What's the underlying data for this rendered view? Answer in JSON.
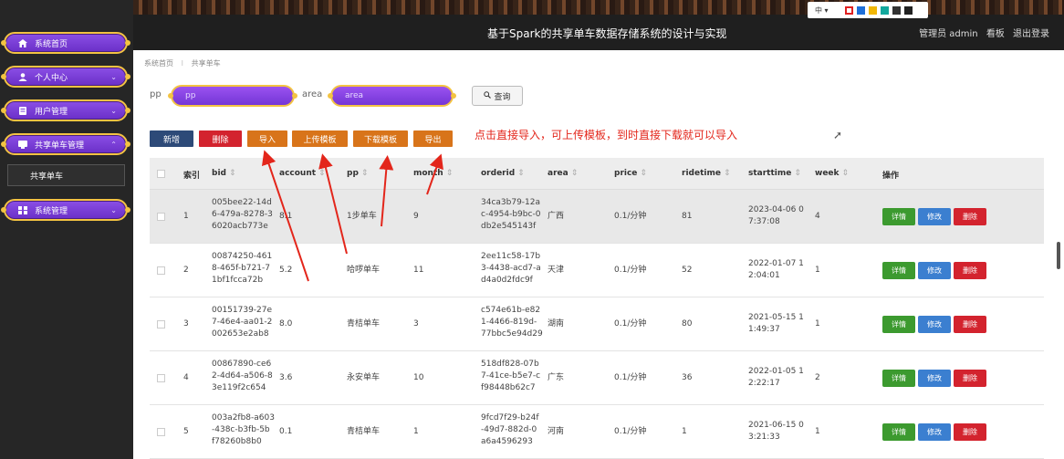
{
  "sidebar": {
    "items": [
      {
        "label": "系统首页",
        "icon": "home-icon",
        "chevron": ""
      },
      {
        "label": "个人中心",
        "icon": "user-icon",
        "chevron": "⌄"
      },
      {
        "label": "用户管理",
        "icon": "user-manage-icon",
        "chevron": "⌄"
      },
      {
        "label": "共享单车管理",
        "icon": "bike-manage-icon",
        "chevron": "⌃"
      },
      {
        "label": "系统管理",
        "icon": "grid-icon",
        "chevron": "⌄"
      }
    ],
    "submenu_item": "共享单车"
  },
  "header": {
    "title": "基于Spark的共享单车数据存储系统的设计与实现",
    "role": "管理员 admin",
    "board": "看板",
    "logout": "退出登录",
    "lang": "中 ▾",
    "theme_colors": [
      "#e02020",
      "#1e6fd9",
      "#f2b705",
      "#13a89e",
      "#333333",
      "#222222"
    ]
  },
  "breadcrumb": {
    "home": "系统首页",
    "sep": "⁝",
    "current": "共享单车"
  },
  "search": {
    "pp_label": "pp",
    "pp_placeholder": "pp",
    "area_label": "area",
    "area_placeholder": "area",
    "query_label": "查询"
  },
  "actions": {
    "add": "新增",
    "delete": "删除",
    "import": "导入",
    "upload_template": "上传模板",
    "download_template": "下载模板",
    "export": "导出"
  },
  "annotation": "点击直接导入，可上传模板，到时直接下载就可以导入",
  "table": {
    "columns": [
      "索引",
      "bid",
      "account",
      "pp",
      "month",
      "orderid",
      "area",
      "price",
      "ridetime",
      "starttime",
      "week",
      "操作"
    ],
    "row_actions": {
      "detail": "详情",
      "edit": "修改",
      "delete": "删除"
    },
    "rows": [
      {
        "index": "1",
        "bid": [
          "005bee22-14d",
          "6-479a-8278-3",
          "6020acb773e"
        ],
        "account": "8.1",
        "pp": "1步单车",
        "month": "9",
        "orderid": [
          "34ca3b79-12a",
          "c-4954-b9bc-0",
          "db2e545143f"
        ],
        "area": "广西",
        "price": "0.1/分钟",
        "ridetime": "81",
        "starttime": [
          "2023-04-06 0",
          "7:37:08"
        ],
        "week": "4"
      },
      {
        "index": "2",
        "bid": [
          "00874250-461",
          "8-465f-b721-7",
          "1bf1fcca72b"
        ],
        "account": "5.2",
        "pp": "哈啰单车",
        "month": "11",
        "orderid": [
          "2ee11c58-17b",
          "3-4438-acd7-a",
          "d4a0d2fdc9f"
        ],
        "area": "天津",
        "price": "0.1/分钟",
        "ridetime": "52",
        "starttime": [
          "2022-01-07 1",
          "2:04:01"
        ],
        "week": "1"
      },
      {
        "index": "3",
        "bid": [
          "00151739-27e",
          "7-46e4-aa01-2",
          "002653e2ab8"
        ],
        "account": "8.0",
        "pp": "青桔单车",
        "month": "3",
        "orderid": [
          "c574e61b-e82",
          "1-4466-819d-",
          "77bbc5e94d29"
        ],
        "area": "湖南",
        "price": "0.1/分钟",
        "ridetime": "80",
        "starttime": [
          "2021-05-15 1",
          "1:49:37"
        ],
        "week": "1"
      },
      {
        "index": "4",
        "bid": [
          "00867890-ce6",
          "2-4d64-a506-8",
          "3e119f2c654"
        ],
        "account": "3.6",
        "pp": "永安单车",
        "month": "10",
        "orderid": [
          "518df828-07b",
          "7-41ce-b5e7-c",
          "f98448b62c7"
        ],
        "area": "广东",
        "price": "0.1/分钟",
        "ridetime": "36",
        "starttime": [
          "2022-01-05 1",
          "2:22:17"
        ],
        "week": "2"
      },
      {
        "index": "5",
        "bid": [
          "003a2fb8-a603",
          "-438c-b3fb-5b",
          "f78260b8b0"
        ],
        "account": "0.1",
        "pp": "青桔单车",
        "month": "1",
        "orderid": [
          "9fcd7f29-b24f",
          "-49d7-882d-0",
          "a6a4596293"
        ],
        "area": "河南",
        "price": "0.1/分钟",
        "ridetime": "1",
        "starttime": [
          "2021-06-15 0",
          "3:21:33"
        ],
        "week": "1"
      }
    ]
  }
}
